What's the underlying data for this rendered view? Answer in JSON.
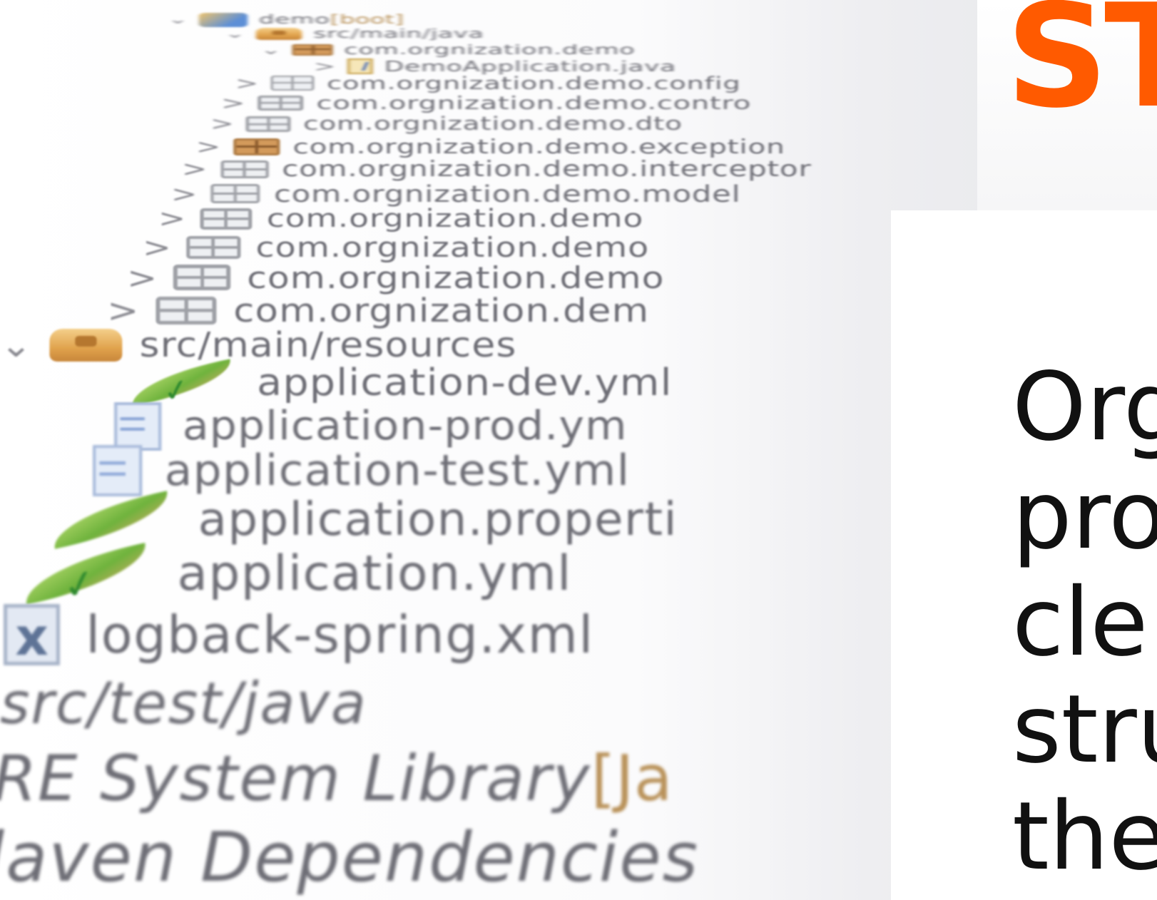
{
  "project_explorer": {
    "items": [
      {
        "id": "project",
        "label": "demo",
        "decoration": " [boot]",
        "icon": "project-icon",
        "chevron": "⌄"
      },
      {
        "id": "src-main-java",
        "label": "src/main/java",
        "icon": "source-folder-icon",
        "chevron": "⌄"
      },
      {
        "id": "pkg-demo",
        "label": "com.orgnization.demo",
        "icon": "main-package-icon",
        "chevron": "⌄"
      },
      {
        "id": "demo-application",
        "label": "DemoApplication.java",
        "icon": "java-file-icon",
        "chevron": ">"
      },
      {
        "id": "pkg-config",
        "label": "com.orgnization.demo.config",
        "icon": "package-icon",
        "chevron": ">"
      },
      {
        "id": "pkg-controller",
        "label": "com.orgnization.demo.contro",
        "icon": "package-icon",
        "chevron": ">"
      },
      {
        "id": "pkg-dto",
        "label": "com.orgnization.demo.dto",
        "icon": "package-icon",
        "chevron": ">"
      },
      {
        "id": "pkg-exception",
        "label": "com.orgnization.demo.exception",
        "icon": "main-package-icon",
        "chevron": ">"
      },
      {
        "id": "pkg-interceptor",
        "label": "com.orgnization.demo.interceptor",
        "icon": "package-icon",
        "chevron": ">"
      },
      {
        "id": "pkg-model",
        "label": "com.orgnization.demo.model",
        "icon": "package-icon",
        "chevron": ">"
      },
      {
        "id": "pkg-a",
        "label": "com.orgnization.demo",
        "icon": "package-icon",
        "chevron": ">"
      },
      {
        "id": "pkg-b",
        "label": "com.orgnization.demo",
        "icon": "package-icon",
        "chevron": ">"
      },
      {
        "id": "pkg-c",
        "label": "com.orgnization.demo",
        "icon": "package-icon",
        "chevron": ">"
      },
      {
        "id": "pkg-d",
        "label": "com.orgnization.dem",
        "icon": "package-icon",
        "chevron": ">"
      },
      {
        "id": "src-main-resources",
        "label": "src/main/resources",
        "icon": "source-folder-icon",
        "chevron": "⌄"
      },
      {
        "id": "app-dev-yml",
        "label": "application-dev.yml",
        "icon": "spring-boot-icon",
        "chevron": ""
      },
      {
        "id": "app-prod-yml",
        "label": "application-prod.ym",
        "icon": "text-file-icon",
        "chevron": ""
      },
      {
        "id": "app-test-yml",
        "label": "application-test.yml",
        "icon": "text-file-icon",
        "chevron": ""
      },
      {
        "id": "app-properties",
        "label": "application.properti",
        "icon": "spring-leaf-icon",
        "chevron": ""
      },
      {
        "id": "app-yml",
        "label": "application.yml",
        "icon": "spring-boot-icon",
        "chevron": ""
      },
      {
        "id": "logback-xml",
        "label": "logback-spring.xml",
        "icon": "xml-file-icon",
        "chevron": ""
      },
      {
        "id": "src-test-java",
        "label": "src/test/java",
        "icon": "",
        "chevron": ""
      },
      {
        "id": "jre-library",
        "label": "RE System Library",
        "decoration": " [Ja",
        "icon": "",
        "chevron": ""
      },
      {
        "id": "maven-deps",
        "label": "laven Dependencies",
        "icon": "",
        "chevron": ""
      }
    ]
  },
  "heading": {
    "text": "ST",
    "color": "#ff5a00"
  },
  "body_text": {
    "lines": [
      "Org",
      "pro",
      "cle",
      "stru",
      "the"
    ]
  }
}
